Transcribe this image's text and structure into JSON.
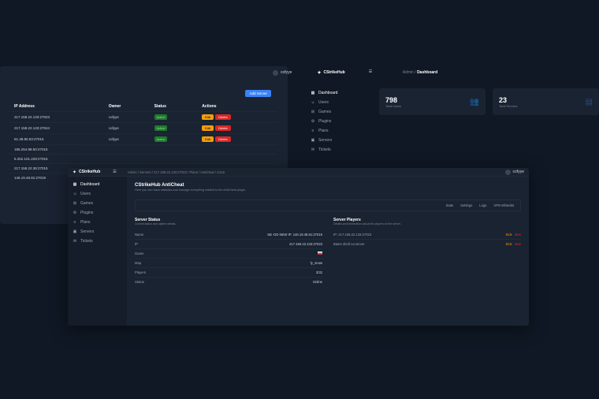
{
  "topbar": {
    "user": "cofyye",
    "brand": "CStrikeHub",
    "breadcrumb_prefix": "Admin / ",
    "breadcrumb_current": "Dashboard"
  },
  "nav1": [
    {
      "icon": "▦",
      "label": "Dashboard",
      "active": true
    },
    {
      "icon": "☺",
      "label": "Users"
    },
    {
      "icon": "⊞",
      "label": "Games"
    },
    {
      "icon": "⚙",
      "label": "Plugins"
    },
    {
      "icon": "≡",
      "label": "Plans"
    },
    {
      "icon": "▣",
      "label": "Servers"
    },
    {
      "icon": "✉",
      "label": "Tickets"
    }
  ],
  "stats": [
    {
      "num": "798",
      "label": "Total Users",
      "icon": "👥"
    },
    {
      "num": "23",
      "label": "Total Servers",
      "icon": "▤"
    }
  ],
  "servers": {
    "add_label": "Add Server",
    "cols": [
      "IP Address",
      "Owner",
      "Status",
      "Actions"
    ],
    "edit_label": "Edit",
    "del_label": "Delete",
    "rows": [
      {
        "ip": "217.158.22.133:27023",
        "owner": "cofyye",
        "status": "Active",
        "actions": true
      },
      {
        "ip": "217.158.22.133:27044",
        "owner": "cofyye",
        "status": "Active",
        "actions": true
      },
      {
        "ip": "51.38.80.53:27015",
        "owner": "cofyye",
        "status": "Active",
        "actions": true
      },
      {
        "ip": "185.254.98.50:27015",
        "owner": "",
        "status": "",
        "actions": false
      },
      {
        "ip": "5.252.101.229:27015",
        "owner": "",
        "status": "",
        "actions": false
      },
      {
        "ip": "217.158.22.38:27015",
        "owner": "",
        "status": "",
        "actions": false
      },
      {
        "ip": "146.19.48.81:27019",
        "owner": "",
        "status": "",
        "actions": false
      }
    ]
  },
  "win2": {
    "brand": "CStrikeHub",
    "breadcrumb": "Admin / Servers / 217.158.22.133:27023 / Plans / Anticheat / Cs16",
    "user": "cofyye",
    "nav": [
      {
        "icon": "▦",
        "label": "Dashboard",
        "active": true
      },
      {
        "icon": "☺",
        "label": "Users"
      },
      {
        "icon": "⊞",
        "label": "Games"
      },
      {
        "icon": "⚙",
        "label": "Plugins"
      },
      {
        "icon": "≡",
        "label": "Plans"
      },
      {
        "icon": "▣",
        "label": "Servers"
      },
      {
        "icon": "✉",
        "label": "Tickets"
      }
    ],
    "title": "CStrikeHub AntiCheat",
    "subtitle": "Here you can track statistics and manage everything related to the AntiCheat plugin.",
    "tabs": [
      "Stats",
      "Settings",
      "Logs",
      "VPN Whitelist"
    ],
    "status": {
      "title": "Server Status",
      "sub": "Current status and uptime details.",
      "rows": [
        {
          "k": "Name",
          "v": "SB -DD NEW IP: 146.19.48.81:27019"
        },
        {
          "k": "IP",
          "v": "217.158.22.133:27023"
        },
        {
          "k": "Game",
          "v": "",
          "flag": true
        },
        {
          "k": "Map",
          "v": "fy_snow"
        },
        {
          "k": "Players",
          "v": "3/32"
        },
        {
          "k": "Status",
          "v": "Online",
          "green": true
        }
      ]
    },
    "players": {
      "title": "Server Players",
      "sub": "Details and information about the players on the server.",
      "kick_label": "Kick",
      "ban_label": "Ban",
      "rows": [
        {
          "ip": "IP: 217.158.22.133:27023"
        },
        {
          "ip": "Bates shoft na server"
        }
      ]
    }
  }
}
